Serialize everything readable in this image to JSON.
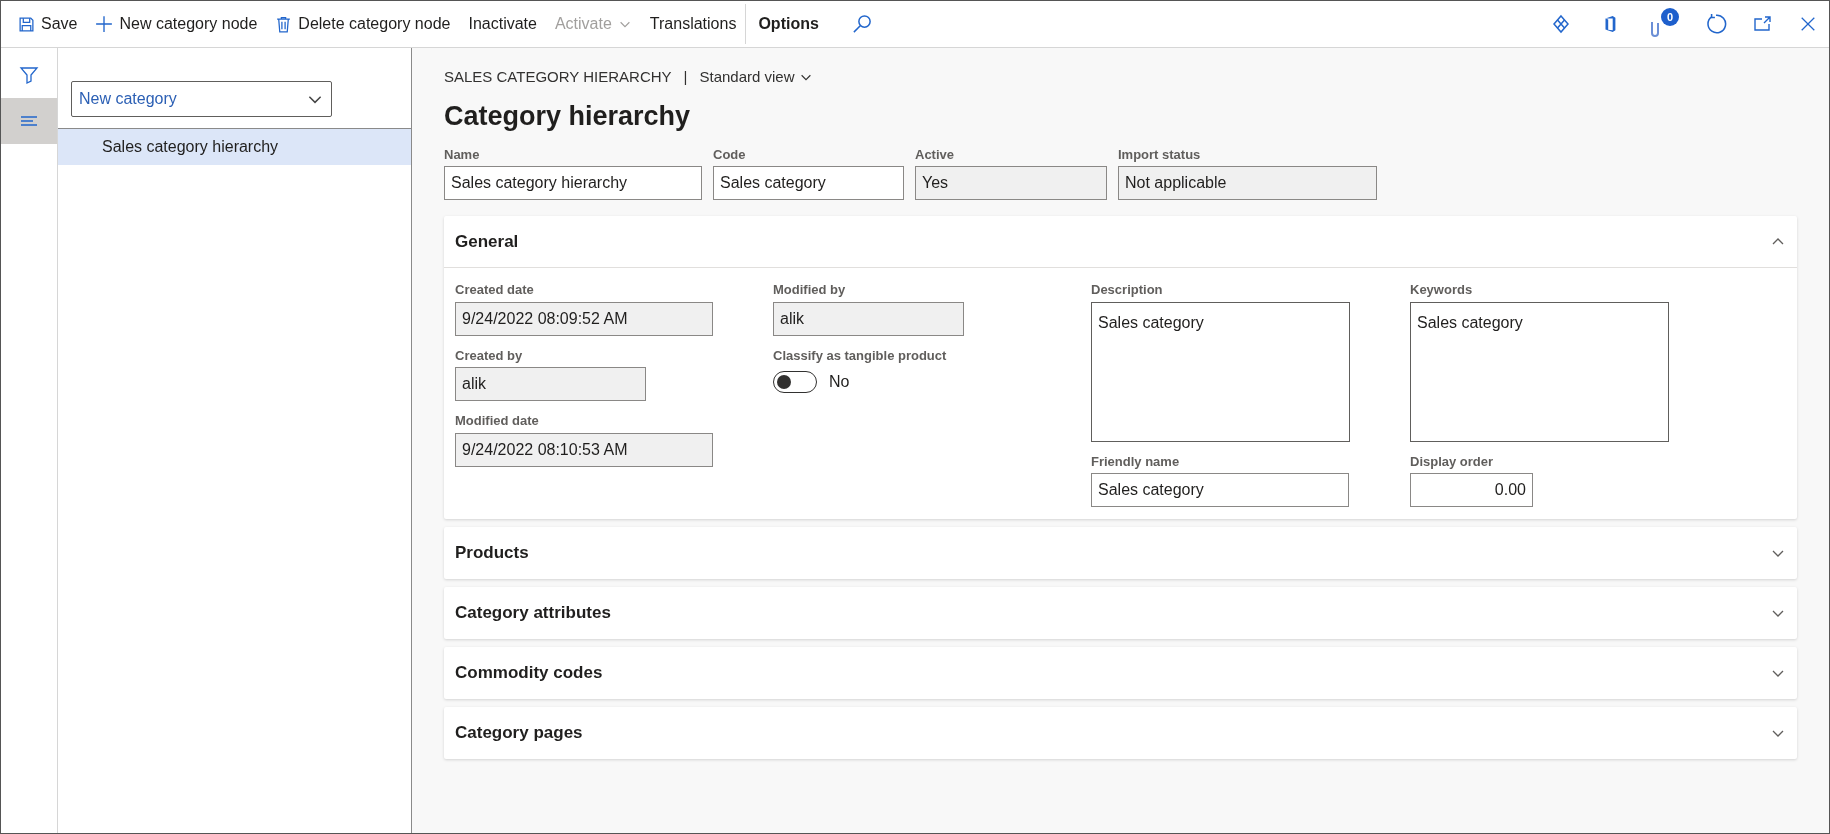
{
  "toolbar": {
    "items": [
      {
        "label": "Save",
        "disabled": false,
        "dropdown": false,
        "emphasized": false
      },
      {
        "label": "New category node",
        "disabled": false,
        "dropdown": false,
        "emphasized": false
      },
      {
        "label": "Delete category node",
        "disabled": false,
        "dropdown": false,
        "emphasized": false
      },
      {
        "label": "Inactivate",
        "disabled": false,
        "dropdown": false,
        "emphasized": false
      },
      {
        "label": "Activate",
        "disabled": true,
        "dropdown": true,
        "emphasized": false
      },
      {
        "label": "Translations",
        "disabled": false,
        "dropdown": false,
        "emphasized": false
      },
      {
        "label": "Options",
        "disabled": false,
        "dropdown": false,
        "emphasized": true
      }
    ],
    "attachments_badge": "0"
  },
  "rail": [
    {
      "selected": false
    },
    {
      "selected": true
    }
  ],
  "tree": {
    "dropdown": "New category",
    "items": [
      {
        "label": "Sales category hierarchy",
        "selected": true
      }
    ]
  },
  "header": {
    "breadcrumb": "SALES CATEGORY HIERARCHY",
    "separator": "|",
    "view": "Standard view",
    "title": "Category hierarchy",
    "fields": [
      {
        "label": "Name",
        "value": "Sales category hierarchy",
        "readonly": false
      },
      {
        "label": "Code",
        "value": "Sales category",
        "readonly": false
      },
      {
        "label": "Active",
        "value": "Yes",
        "readonly": true
      },
      {
        "label": "Import status",
        "value": "Not applicable",
        "readonly": true
      }
    ]
  },
  "sections": [
    {
      "title": "General",
      "expanded": true,
      "columns": [
        [
          {
            "kind": "text",
            "label": "Created date",
            "value": "9/24/2022 08:09:52 AM",
            "readonly": true
          },
          {
            "kind": "text",
            "label": "Created by",
            "value": "alik",
            "readonly": true
          },
          {
            "kind": "text",
            "label": "Modified date",
            "value": "9/24/2022 08:10:53 AM",
            "readonly": true
          }
        ],
        [
          {
            "kind": "text",
            "label": "Modified by",
            "value": "alik",
            "readonly": true
          },
          {
            "kind": "toggle",
            "label": "Classify as tangible product",
            "value": "No",
            "checked": false
          }
        ],
        [
          {
            "kind": "textarea",
            "label": "Description",
            "value": "Sales category",
            "readonly": false
          },
          {
            "kind": "text",
            "label": "Friendly name",
            "value": "Sales category",
            "readonly": false
          }
        ],
        [
          {
            "kind": "textarea",
            "label": "Keywords",
            "value": "Sales category",
            "readonly": false
          },
          {
            "kind": "number",
            "label": "Display order",
            "value": "0.00",
            "readonly": false
          }
        ]
      ]
    },
    {
      "title": "Products",
      "expanded": false
    },
    {
      "title": "Category attributes",
      "expanded": false
    },
    {
      "title": "Commodity codes",
      "expanded": false
    },
    {
      "title": "Category pages",
      "expanded": false
    }
  ]
}
